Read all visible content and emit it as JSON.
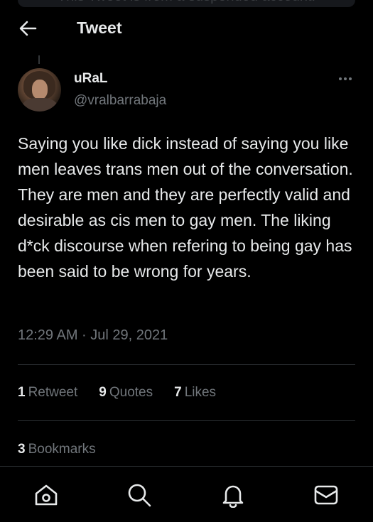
{
  "header": {
    "banner_text": "This Tweet is from a suspended account.",
    "title": "Tweet",
    "back_icon": "arrow-left-icon"
  },
  "tweet": {
    "author": {
      "display_name": "uRaL",
      "handle": "@vralbarrabaja"
    },
    "text": "Saying you like dick instead of saying you like men leaves trans men out of the conversation. They are men and they are perfectly valid and desirable as cis men to gay men. The liking d*ck discourse when refering to being gay has been said to be wrong for years.",
    "timestamp": "12:29 AM · Jul 29, 2021",
    "stats": {
      "retweets_count": "1",
      "retweets_label": "Retweet",
      "quotes_count": "9",
      "quotes_label": "Quotes",
      "likes_count": "7",
      "likes_label": "Likes",
      "bookmarks_count": "3",
      "bookmarks_label": "Bookmarks"
    }
  },
  "bottom_nav": {
    "items": [
      "home-icon",
      "search-icon",
      "notifications-icon",
      "messages-icon"
    ]
  },
  "colors": {
    "background": "#000000",
    "text_primary": "#e7e9ea",
    "text_secondary": "#71767b",
    "divider": "#2f3336"
  }
}
